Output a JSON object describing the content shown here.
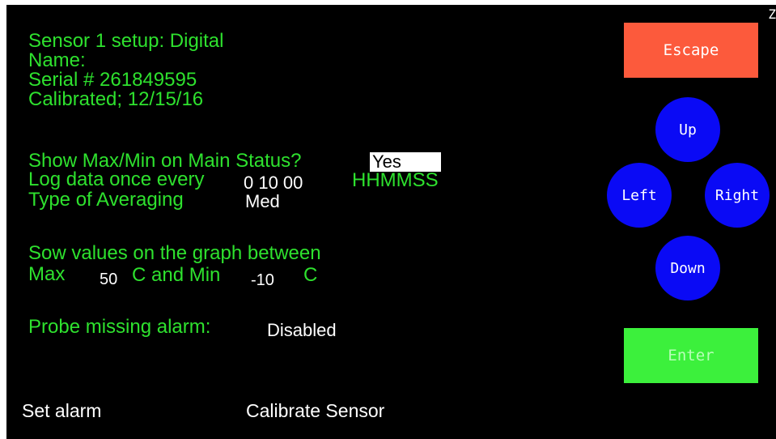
{
  "sensor": {
    "setup_line": "Sensor 1 setup:  Digital",
    "name_line": "Name:",
    "serial_line": "Serial # 261849595",
    "calibrated_line": "Calibrated; 12/15/16"
  },
  "settings": {
    "show_maxmin_label": "Show Max/Min on Main Status?",
    "show_maxmin_value": "Yes",
    "log_label": "Log data once every",
    "log_value": "0 10 00",
    "log_unit": "HHMMSS",
    "averaging_label": "Type of Averaging",
    "averaging_value": "Med"
  },
  "graph": {
    "heading": "Sow values on the graph between",
    "max_label": "Max",
    "max_value": "50",
    "middle_label": "C and Min",
    "min_value": "-10",
    "unit": "C"
  },
  "alarm": {
    "probe_label": "Probe missing alarm:",
    "probe_value": "Disabled"
  },
  "bottom": {
    "set_alarm": "Set alarm",
    "calibrate": "Calibrate Sensor"
  },
  "buttons": {
    "escape": "Escape",
    "up": "Up",
    "left": "Left",
    "right": "Right",
    "down": "Down",
    "enter": "Enter"
  },
  "corner_glyph": "Z",
  "colors": {
    "background": "#000000",
    "label_green": "#2ee12e",
    "escape": "#fc5a3c",
    "nav_blue": "#0a0af5",
    "enter_green": "#3cf03c"
  }
}
